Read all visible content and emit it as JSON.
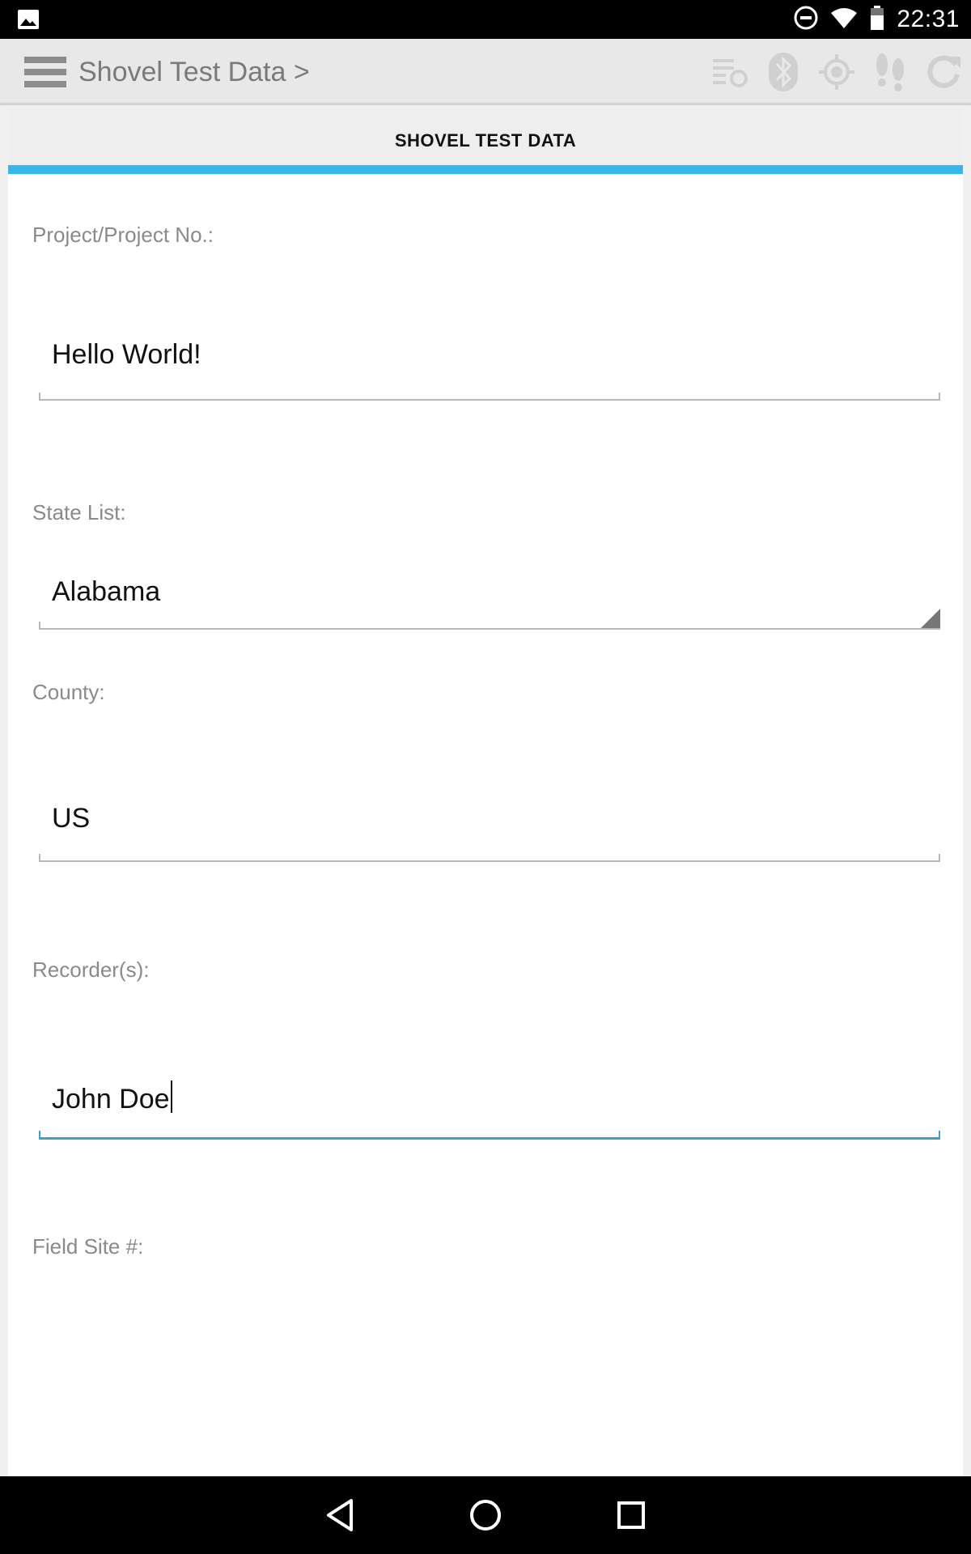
{
  "status_bar": {
    "time": "22:31",
    "icons": [
      "image-icon",
      "do-not-disturb-icon",
      "wifi-icon",
      "battery-icon"
    ]
  },
  "app_bar": {
    "title": "Shovel Test Data >",
    "menu_icon": "hamburger-menu-icon",
    "actions": [
      "sync-list-icon",
      "bluetooth-icon",
      "gps-target-icon",
      "footsteps-icon",
      "refresh-icon"
    ]
  },
  "tab": {
    "label": "SHOVEL TEST DATA",
    "indicator_color": "#3bb5e6"
  },
  "form": {
    "project": {
      "label": "Project/Project No.:",
      "value": "Hello World!"
    },
    "state": {
      "label": "State List:",
      "value": "Alabama"
    },
    "county": {
      "label": "County:",
      "value": "US"
    },
    "recorders": {
      "label": "Recorder(s):",
      "value": "John Doe"
    },
    "field_site": {
      "label": "Field Site #:"
    }
  },
  "nav_bar": {
    "icons": [
      "back-icon",
      "home-icon",
      "recents-icon"
    ]
  },
  "colors": {
    "accent": "#3bb5e6",
    "focus_underline": "#3aa0c8"
  }
}
